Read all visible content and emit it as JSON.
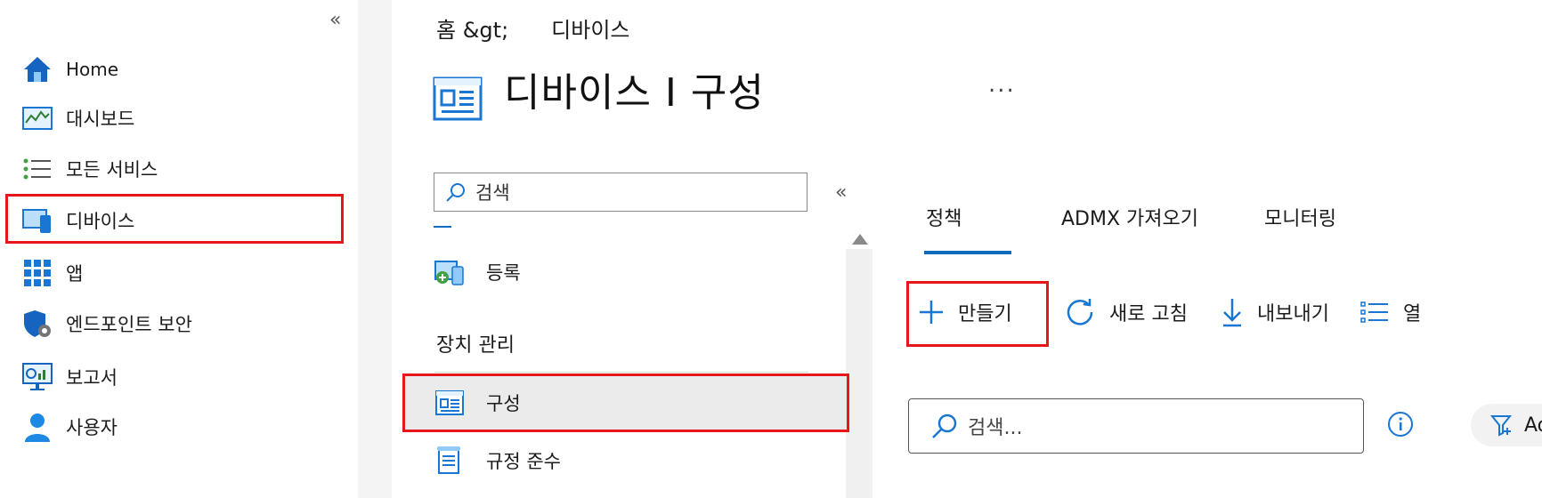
{
  "left_nav": {
    "items": [
      {
        "label": "Home",
        "icon": "home-icon"
      },
      {
        "label": "대시보드",
        "icon": "dashboard-icon"
      },
      {
        "label": "모든 서비스",
        "icon": "all-services-icon"
      },
      {
        "label": "디바이스",
        "icon": "devices-icon"
      },
      {
        "label": "앱",
        "icon": "apps-icon"
      },
      {
        "label": "엔드포인트 보안",
        "icon": "endpoint-security-icon"
      },
      {
        "label": "보고서",
        "icon": "reports-icon"
      },
      {
        "label": "사용자",
        "icon": "users-icon"
      }
    ],
    "collapse_label": "«"
  },
  "breadcrumb": {
    "home": "홈 &gt;",
    "current": "디바이스"
  },
  "page": {
    "title": "디바이스 I 구성",
    "more": "..."
  },
  "mid": {
    "search_placeholder": "검색",
    "collapse_label": "«",
    "items": [
      {
        "label": "등록",
        "icon": "enrollment-icon"
      },
      {
        "label": "구성",
        "icon": "configuration-icon"
      },
      {
        "label": "규정 준수",
        "icon": "compliance-icon"
      }
    ],
    "section_heading": "장치 관리"
  },
  "tabs": [
    {
      "label": "정책",
      "selected": true
    },
    {
      "label": "ADMX 가져오기",
      "selected": false
    },
    {
      "label": "모니터링",
      "selected": false
    }
  ],
  "toolbar": {
    "create": "만들기",
    "refresh": "새로 고침",
    "export": "내보내기",
    "columns": "열"
  },
  "list_search": {
    "placeholder": "검색..."
  },
  "filter": {
    "label": "Ad"
  },
  "colors": {
    "accent": "#0f6cbd",
    "highlight": "#e8161b"
  }
}
